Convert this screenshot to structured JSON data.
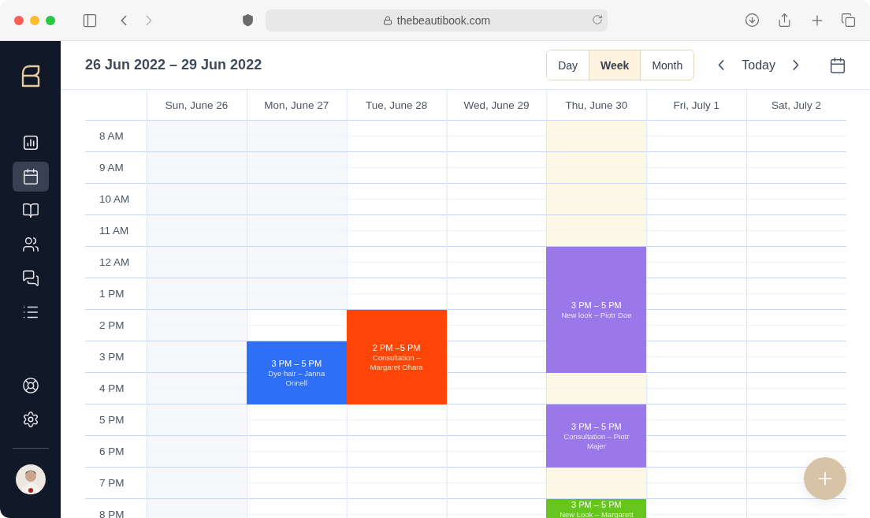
{
  "browser": {
    "url": "thebeautibook.com"
  },
  "sidebar": {
    "items": [
      {
        "kind": "chart",
        "selected": false
      },
      {
        "kind": "calendar",
        "selected": true
      },
      {
        "kind": "book",
        "selected": false
      },
      {
        "kind": "users",
        "selected": false
      },
      {
        "kind": "messages",
        "selected": false
      },
      {
        "kind": "list",
        "selected": false
      }
    ],
    "bottom_items": [
      {
        "kind": "help"
      },
      {
        "kind": "settings"
      }
    ]
  },
  "header": {
    "title": "26 Jun 2022 – 29 Jun 2022",
    "views": [
      {
        "label": "Day",
        "selected": false
      },
      {
        "label": "Week",
        "selected": true
      },
      {
        "label": "Month",
        "selected": false
      }
    ],
    "today": "Today"
  },
  "hours": [
    "8 AM",
    "9 AM",
    "10 AM",
    "11 AM",
    "12 AM",
    "1 PM",
    "2 PM",
    "3 PM",
    "4 PM",
    "5 PM",
    "6 PM",
    "7 PM",
    "8 PM"
  ],
  "days": [
    {
      "label": "Sun, June 26",
      "cells": [
        {
          "kind": "past"
        },
        {
          "kind": "past"
        },
        {
          "kind": "past"
        },
        {
          "kind": "past"
        },
        {
          "kind": "past"
        },
        {
          "kind": "past"
        },
        {
          "kind": "past"
        },
        {
          "kind": "past"
        },
        {
          "kind": "past"
        },
        {
          "kind": "past"
        },
        {
          "kind": "past"
        },
        {
          "kind": "past"
        },
        {
          "kind": "past"
        }
      ]
    },
    {
      "label": "Mon, June 27",
      "cells": [
        {
          "kind": "past"
        },
        {
          "kind": "past"
        },
        {
          "kind": "past"
        },
        {
          "kind": "past"
        },
        {
          "kind": "past"
        },
        {
          "kind": "past"
        },
        {
          "kind": "free"
        },
        {
          "kind": "event"
        },
        {
          "kind": "more"
        },
        {
          "kind": "free"
        },
        {
          "kind": "free"
        },
        {
          "kind": "free"
        },
        {
          "kind": "free"
        }
      ],
      "events": [
        {
          "time": "3 PM – 5 PM",
          "title": "Dye hair – Janna Onnell",
          "color": "#2f6ff5"
        }
      ]
    },
    {
      "label": "Tue, June 28",
      "cells": [
        {
          "kind": "free"
        },
        {
          "kind": "free"
        },
        {
          "kind": "free"
        },
        {
          "kind": "free"
        },
        {
          "kind": "free"
        },
        {
          "kind": "free"
        },
        {
          "kind": "event"
        },
        {
          "kind": "more"
        },
        {
          "kind": "more"
        },
        {
          "kind": "free"
        },
        {
          "kind": "free"
        },
        {
          "kind": "free"
        },
        {
          "kind": "free"
        }
      ],
      "events": [
        {
          "time": "2 PM –5 PM",
          "title": "Consultation – Margaret Ohara",
          "color": "#ff4508"
        }
      ]
    },
    {
      "label": "Wed, June 29",
      "cells": [
        {
          "kind": "free"
        },
        {
          "kind": "free"
        },
        {
          "kind": "free"
        },
        {
          "kind": "free"
        },
        {
          "kind": "free"
        },
        {
          "kind": "free"
        },
        {
          "kind": "free"
        },
        {
          "kind": "free"
        },
        {
          "kind": "free"
        },
        {
          "kind": "free"
        },
        {
          "kind": "free"
        },
        {
          "kind": "free"
        },
        {
          "kind": "free"
        }
      ]
    },
    {
      "label": "Thu, June 30",
      "cells": [
        {
          "kind": "today"
        },
        {
          "kind": "today"
        },
        {
          "kind": "today"
        },
        {
          "kind": "today"
        },
        {
          "kind": "event"
        },
        {
          "kind": "more"
        },
        {
          "kind": "more"
        },
        {
          "kind": "more"
        },
        {
          "kind": "today"
        },
        {
          "kind": "event"
        },
        {
          "kind": "more"
        },
        {
          "kind": "today"
        },
        {
          "kind": "event"
        }
      ],
      "events": [
        {
          "time": "3 PM – 5 PM",
          "title": "New look – Piotr Doe",
          "color": "#9b78ea"
        },
        {
          "time": "3 PM – 5 PM",
          "title": "Consultation – Piotr Majer",
          "color": "#9b78ea"
        },
        {
          "time": "3 PM – 5 PM",
          "title": "New Look – Margarett",
          "color": "#67c61d"
        }
      ]
    },
    {
      "label": "Fri, July 1",
      "cells": [
        {
          "kind": "free"
        },
        {
          "kind": "free"
        },
        {
          "kind": "free"
        },
        {
          "kind": "free"
        },
        {
          "kind": "free"
        },
        {
          "kind": "free"
        },
        {
          "kind": "free"
        },
        {
          "kind": "free"
        },
        {
          "kind": "free"
        },
        {
          "kind": "free"
        },
        {
          "kind": "free"
        },
        {
          "kind": "free"
        },
        {
          "kind": "free"
        }
      ]
    },
    {
      "label": "Sat, July 2",
      "cells": [
        {
          "kind": "free"
        },
        {
          "kind": "free"
        },
        {
          "kind": "free"
        },
        {
          "kind": "free"
        },
        {
          "kind": "free"
        },
        {
          "kind": "free"
        },
        {
          "kind": "free"
        },
        {
          "kind": "free"
        },
        {
          "kind": "free"
        },
        {
          "kind": "free"
        },
        {
          "kind": "free"
        },
        {
          "kind": "free"
        },
        {
          "kind": "free"
        }
      ]
    }
  ]
}
